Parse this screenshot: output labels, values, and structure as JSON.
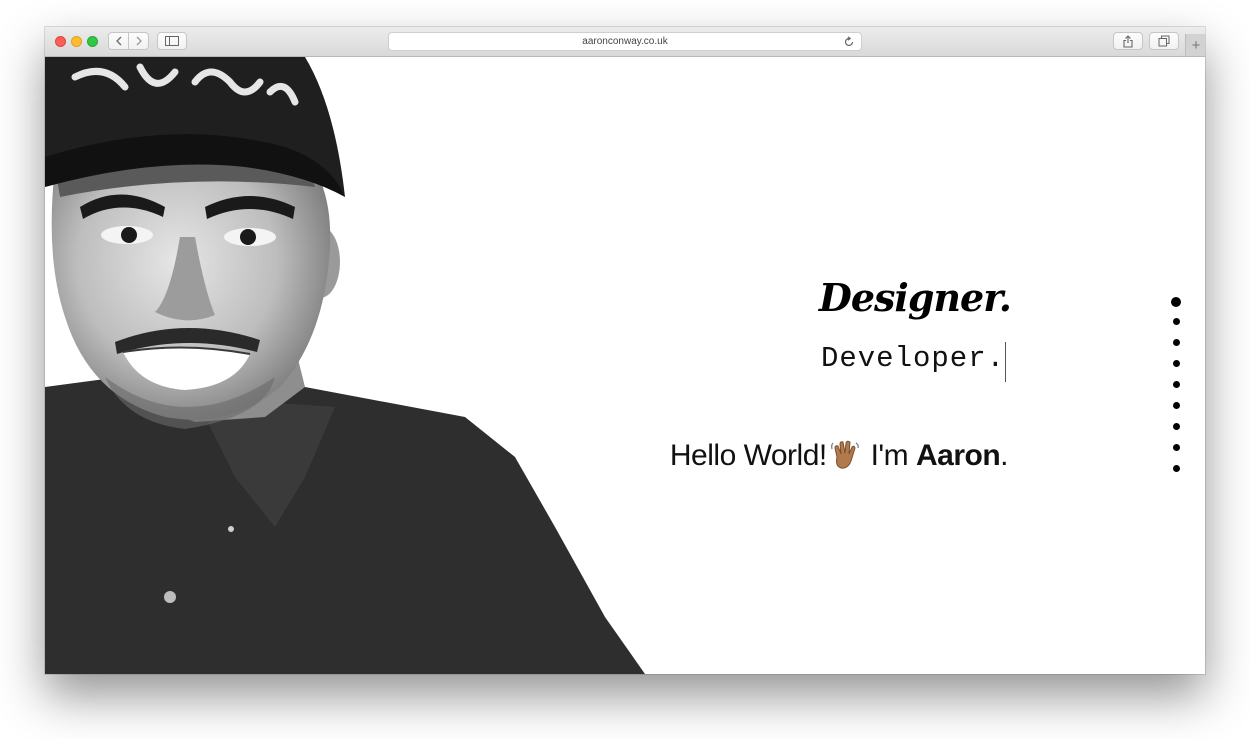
{
  "browser": {
    "url": "aaronconway.co.uk",
    "new_tab_symbol": "+",
    "icons": [
      "back-icon",
      "forward-icon",
      "sidebar-icon",
      "reload-icon",
      "share-icon",
      "tabs-icon"
    ]
  },
  "hero": {
    "role_1": "Designer.",
    "role_2": "Developer.",
    "greeting_prefix": "Hello World!",
    "greeting_mid": " I'm ",
    "name": "Aaron",
    "greeting_suffix": "."
  },
  "pagination": {
    "count": 9,
    "active_index": 0
  },
  "colors": {
    "accent": "#000000",
    "traffic_close": "#fc5f57",
    "traffic_min": "#fdbc2e",
    "traffic_max": "#33c748"
  }
}
